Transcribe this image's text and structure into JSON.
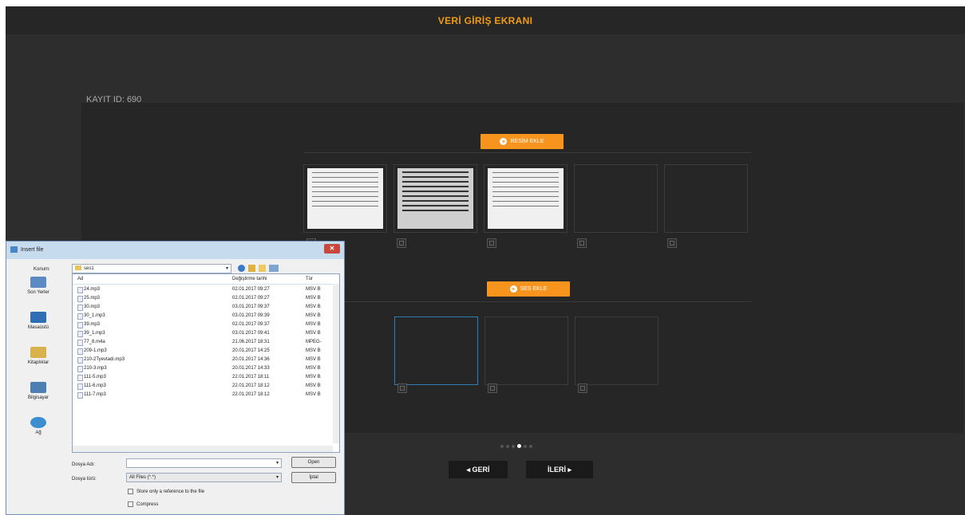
{
  "page": {
    "title": "VERİ GİRİŞ EKRANI",
    "record_label": "KAYIT ID: 690"
  },
  "images_section": {
    "add_button_label": "RESİM EKLE"
  },
  "audio_section": {
    "add_button_label": "SES EKLE"
  },
  "pagination": {
    "count": 6,
    "active_index": 3
  },
  "nav": {
    "back_label": "◂ GERİ",
    "next_label": "İLERİ ▸"
  },
  "colors": {
    "accent": "#f7941d",
    "background": "#2d2d2d",
    "panel": "#262626",
    "selected_border": "#2e7fb8"
  },
  "dialog": {
    "title": "Insert file",
    "look_in_label": "Konum:",
    "look_in_value": "ses1",
    "places": [
      {
        "label": "Son Yerler",
        "icon": "recent-places-icon",
        "color": "#5b8ac4"
      },
      {
        "label": "Masaüstü",
        "icon": "desktop-icon",
        "color": "#2f6db5"
      },
      {
        "label": "Kitaplıklar",
        "icon": "libraries-icon",
        "color": "#d9b24b"
      },
      {
        "label": "Bilgisayar",
        "icon": "computer-icon",
        "color": "#4d7fb3"
      },
      {
        "label": "Ağ",
        "icon": "network-icon",
        "color": "#3b8fd0"
      }
    ],
    "columns": {
      "name": "Ad",
      "date": "Değiştirme tarihi",
      "type": "Tür"
    },
    "files": [
      {
        "name": "24.mp3",
        "date": "02.01.2017 09:27",
        "type": "MSV B"
      },
      {
        "name": "25.mp3",
        "date": "02.01.2017 09:27",
        "type": "MSV B"
      },
      {
        "name": "30.mp3",
        "date": "03.01.2017 09:37",
        "type": "MSV B"
      },
      {
        "name": "30_1.mp3",
        "date": "03.01.2017 09:39",
        "type": "MSV B"
      },
      {
        "name": "39.mp3",
        "date": "02.01.2017 09:37",
        "type": "MSV B"
      },
      {
        "name": "39_1.mp3",
        "date": "03.01.2017 09:41",
        "type": "MSV B"
      },
      {
        "name": "77_8.m4a",
        "date": "21.06.2017 18:31",
        "type": "MPEG-"
      },
      {
        "name": "209-1.mp3",
        "date": "20.01.2017 14:25",
        "type": "MSV B"
      },
      {
        "name": "210-2Tyevtadi.mp3",
        "date": "20.01.2017 14:36",
        "type": "MSV B"
      },
      {
        "name": "210-3.mp3",
        "date": "20.01.2017 14:33",
        "type": "MSV B"
      },
      {
        "name": "111-5.mp3",
        "date": "22.01.2017 18:11",
        "type": "MSV B"
      },
      {
        "name": "111-6.mp3",
        "date": "22.01.2017 18:12",
        "type": "MSV B"
      },
      {
        "name": "111-7.mp3",
        "date": "22.01.2017 18:12",
        "type": "MSV B"
      }
    ],
    "filename_label": "Dosya Adı:",
    "filename_value": "",
    "filetype_label": "Dosya türü:",
    "filetype_value": "All Files (*.*)",
    "open_label": "Open",
    "cancel_label": "İptal",
    "checkbox1_label": "Store only a reference to the file",
    "checkbox2_label": "Compress"
  }
}
